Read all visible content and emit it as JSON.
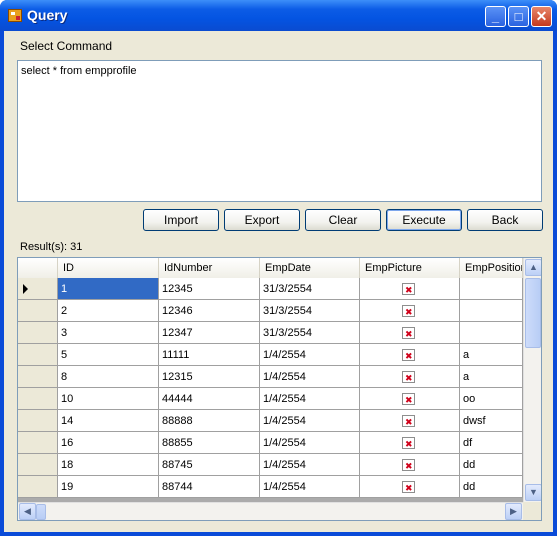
{
  "window": {
    "title": "Query"
  },
  "labels": {
    "select_command": "Select Command",
    "result_count": "Result(s): 31"
  },
  "command": {
    "value": "select * from empprofile"
  },
  "buttons": {
    "import": "Import",
    "export": "Export",
    "clear": "Clear",
    "execute": "Execute",
    "back": "Back"
  },
  "grid": {
    "columns": [
      "ID",
      "IdNumber",
      "EmpDate",
      "EmpPicture",
      "EmpPosition"
    ],
    "rows": [
      {
        "id": "1",
        "idnumber": "12345",
        "empdate": "31/3/2554",
        "picture": "broken-image-icon",
        "position": ""
      },
      {
        "id": "2",
        "idnumber": "12346",
        "empdate": "31/3/2554",
        "picture": "broken-image-icon",
        "position": ""
      },
      {
        "id": "3",
        "idnumber": "12347",
        "empdate": "31/3/2554",
        "picture": "broken-image-icon",
        "position": ""
      },
      {
        "id": "5",
        "idnumber": "11111",
        "empdate": "1/4/2554",
        "picture": "broken-image-icon",
        "position": "a"
      },
      {
        "id": "8",
        "idnumber": "12315",
        "empdate": "1/4/2554",
        "picture": "broken-image-icon",
        "position": "a"
      },
      {
        "id": "10",
        "idnumber": "44444",
        "empdate": "1/4/2554",
        "picture": "broken-image-icon",
        "position": "oo"
      },
      {
        "id": "14",
        "idnumber": "88888",
        "empdate": "1/4/2554",
        "picture": "broken-image-icon",
        "position": "dwsf"
      },
      {
        "id": "16",
        "idnumber": "88855",
        "empdate": "1/4/2554",
        "picture": "broken-image-icon",
        "position": "df"
      },
      {
        "id": "18",
        "idnumber": "88745",
        "empdate": "1/4/2554",
        "picture": "broken-image-icon",
        "position": "dd"
      },
      {
        "id": "19",
        "idnumber": "88744",
        "empdate": "1/4/2554",
        "picture": "broken-image-icon",
        "position": "dd"
      }
    ]
  },
  "colors": {
    "titlebar": "#0454e2",
    "selection": "#316ac5",
    "face": "#ece9d8"
  }
}
